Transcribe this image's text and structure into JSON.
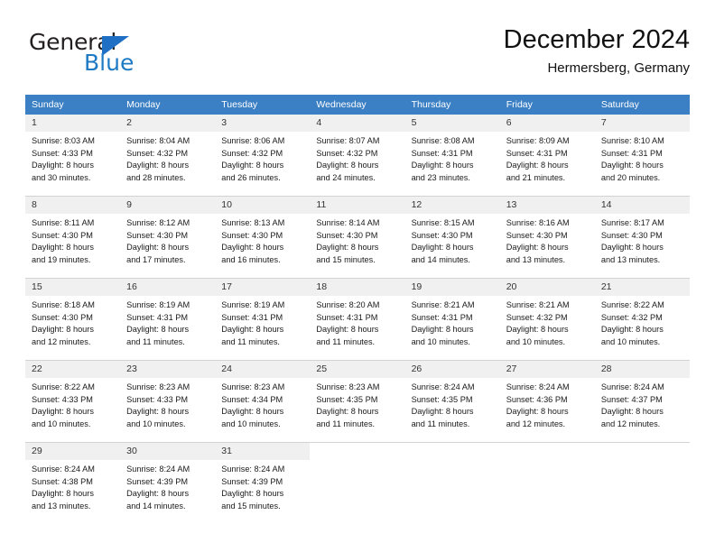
{
  "brand": {
    "name_part1": "General",
    "name_part2": "Blue",
    "accent_color": "#1f7ac4",
    "triangle_color": "#1f6fc4"
  },
  "header": {
    "title": "December 2024",
    "subtitle": "Hermersberg, Germany"
  },
  "calendar": {
    "header_bg": "#3b7fc4",
    "daynum_bg": "#f0f0f0",
    "weekday_headers": [
      "Sunday",
      "Monday",
      "Tuesday",
      "Wednesday",
      "Thursday",
      "Friday",
      "Saturday"
    ],
    "weeks": [
      [
        {
          "day": "1",
          "sunrise": "Sunrise: 8:03 AM",
          "sunset": "Sunset: 4:33 PM",
          "daylight_line1": "Daylight: 8 hours",
          "daylight_line2": "and 30 minutes."
        },
        {
          "day": "2",
          "sunrise": "Sunrise: 8:04 AM",
          "sunset": "Sunset: 4:32 PM",
          "daylight_line1": "Daylight: 8 hours",
          "daylight_line2": "and 28 minutes."
        },
        {
          "day": "3",
          "sunrise": "Sunrise: 8:06 AM",
          "sunset": "Sunset: 4:32 PM",
          "daylight_line1": "Daylight: 8 hours",
          "daylight_line2": "and 26 minutes."
        },
        {
          "day": "4",
          "sunrise": "Sunrise: 8:07 AM",
          "sunset": "Sunset: 4:32 PM",
          "daylight_line1": "Daylight: 8 hours",
          "daylight_line2": "and 24 minutes."
        },
        {
          "day": "5",
          "sunrise": "Sunrise: 8:08 AM",
          "sunset": "Sunset: 4:31 PM",
          "daylight_line1": "Daylight: 8 hours",
          "daylight_line2": "and 23 minutes."
        },
        {
          "day": "6",
          "sunrise": "Sunrise: 8:09 AM",
          "sunset": "Sunset: 4:31 PM",
          "daylight_line1": "Daylight: 8 hours",
          "daylight_line2": "and 21 minutes."
        },
        {
          "day": "7",
          "sunrise": "Sunrise: 8:10 AM",
          "sunset": "Sunset: 4:31 PM",
          "daylight_line1": "Daylight: 8 hours",
          "daylight_line2": "and 20 minutes."
        }
      ],
      [
        {
          "day": "8",
          "sunrise": "Sunrise: 8:11 AM",
          "sunset": "Sunset: 4:30 PM",
          "daylight_line1": "Daylight: 8 hours",
          "daylight_line2": "and 19 minutes."
        },
        {
          "day": "9",
          "sunrise": "Sunrise: 8:12 AM",
          "sunset": "Sunset: 4:30 PM",
          "daylight_line1": "Daylight: 8 hours",
          "daylight_line2": "and 17 minutes."
        },
        {
          "day": "10",
          "sunrise": "Sunrise: 8:13 AM",
          "sunset": "Sunset: 4:30 PM",
          "daylight_line1": "Daylight: 8 hours",
          "daylight_line2": "and 16 minutes."
        },
        {
          "day": "11",
          "sunrise": "Sunrise: 8:14 AM",
          "sunset": "Sunset: 4:30 PM",
          "daylight_line1": "Daylight: 8 hours",
          "daylight_line2": "and 15 minutes."
        },
        {
          "day": "12",
          "sunrise": "Sunrise: 8:15 AM",
          "sunset": "Sunset: 4:30 PM",
          "daylight_line1": "Daylight: 8 hours",
          "daylight_line2": "and 14 minutes."
        },
        {
          "day": "13",
          "sunrise": "Sunrise: 8:16 AM",
          "sunset": "Sunset: 4:30 PM",
          "daylight_line1": "Daylight: 8 hours",
          "daylight_line2": "and 13 minutes."
        },
        {
          "day": "14",
          "sunrise": "Sunrise: 8:17 AM",
          "sunset": "Sunset: 4:30 PM",
          "daylight_line1": "Daylight: 8 hours",
          "daylight_line2": "and 13 minutes."
        }
      ],
      [
        {
          "day": "15",
          "sunrise": "Sunrise: 8:18 AM",
          "sunset": "Sunset: 4:30 PM",
          "daylight_line1": "Daylight: 8 hours",
          "daylight_line2": "and 12 minutes."
        },
        {
          "day": "16",
          "sunrise": "Sunrise: 8:19 AM",
          "sunset": "Sunset: 4:31 PM",
          "daylight_line1": "Daylight: 8 hours",
          "daylight_line2": "and 11 minutes."
        },
        {
          "day": "17",
          "sunrise": "Sunrise: 8:19 AM",
          "sunset": "Sunset: 4:31 PM",
          "daylight_line1": "Daylight: 8 hours",
          "daylight_line2": "and 11 minutes."
        },
        {
          "day": "18",
          "sunrise": "Sunrise: 8:20 AM",
          "sunset": "Sunset: 4:31 PM",
          "daylight_line1": "Daylight: 8 hours",
          "daylight_line2": "and 11 minutes."
        },
        {
          "day": "19",
          "sunrise": "Sunrise: 8:21 AM",
          "sunset": "Sunset: 4:31 PM",
          "daylight_line1": "Daylight: 8 hours",
          "daylight_line2": "and 10 minutes."
        },
        {
          "day": "20",
          "sunrise": "Sunrise: 8:21 AM",
          "sunset": "Sunset: 4:32 PM",
          "daylight_line1": "Daylight: 8 hours",
          "daylight_line2": "and 10 minutes."
        },
        {
          "day": "21",
          "sunrise": "Sunrise: 8:22 AM",
          "sunset": "Sunset: 4:32 PM",
          "daylight_line1": "Daylight: 8 hours",
          "daylight_line2": "and 10 minutes."
        }
      ],
      [
        {
          "day": "22",
          "sunrise": "Sunrise: 8:22 AM",
          "sunset": "Sunset: 4:33 PM",
          "daylight_line1": "Daylight: 8 hours",
          "daylight_line2": "and 10 minutes."
        },
        {
          "day": "23",
          "sunrise": "Sunrise: 8:23 AM",
          "sunset": "Sunset: 4:33 PM",
          "daylight_line1": "Daylight: 8 hours",
          "daylight_line2": "and 10 minutes."
        },
        {
          "day": "24",
          "sunrise": "Sunrise: 8:23 AM",
          "sunset": "Sunset: 4:34 PM",
          "daylight_line1": "Daylight: 8 hours",
          "daylight_line2": "and 10 minutes."
        },
        {
          "day": "25",
          "sunrise": "Sunrise: 8:23 AM",
          "sunset": "Sunset: 4:35 PM",
          "daylight_line1": "Daylight: 8 hours",
          "daylight_line2": "and 11 minutes."
        },
        {
          "day": "26",
          "sunrise": "Sunrise: 8:24 AM",
          "sunset": "Sunset: 4:35 PM",
          "daylight_line1": "Daylight: 8 hours",
          "daylight_line2": "and 11 minutes."
        },
        {
          "day": "27",
          "sunrise": "Sunrise: 8:24 AM",
          "sunset": "Sunset: 4:36 PM",
          "daylight_line1": "Daylight: 8 hours",
          "daylight_line2": "and 12 minutes."
        },
        {
          "day": "28",
          "sunrise": "Sunrise: 8:24 AM",
          "sunset": "Sunset: 4:37 PM",
          "daylight_line1": "Daylight: 8 hours",
          "daylight_line2": "and 12 minutes."
        }
      ],
      [
        {
          "day": "29",
          "sunrise": "Sunrise: 8:24 AM",
          "sunset": "Sunset: 4:38 PM",
          "daylight_line1": "Daylight: 8 hours",
          "daylight_line2": "and 13 minutes."
        },
        {
          "day": "30",
          "sunrise": "Sunrise: 8:24 AM",
          "sunset": "Sunset: 4:39 PM",
          "daylight_line1": "Daylight: 8 hours",
          "daylight_line2": "and 14 minutes."
        },
        {
          "day": "31",
          "sunrise": "Sunrise: 8:24 AM",
          "sunset": "Sunset: 4:39 PM",
          "daylight_line1": "Daylight: 8 hours",
          "daylight_line2": "and 15 minutes."
        },
        {
          "day": "",
          "sunrise": "",
          "sunset": "",
          "daylight_line1": "",
          "daylight_line2": ""
        },
        {
          "day": "",
          "sunrise": "",
          "sunset": "",
          "daylight_line1": "",
          "daylight_line2": ""
        },
        {
          "day": "",
          "sunrise": "",
          "sunset": "",
          "daylight_line1": "",
          "daylight_line2": ""
        },
        {
          "day": "",
          "sunrise": "",
          "sunset": "",
          "daylight_line1": "",
          "daylight_line2": ""
        }
      ]
    ]
  }
}
